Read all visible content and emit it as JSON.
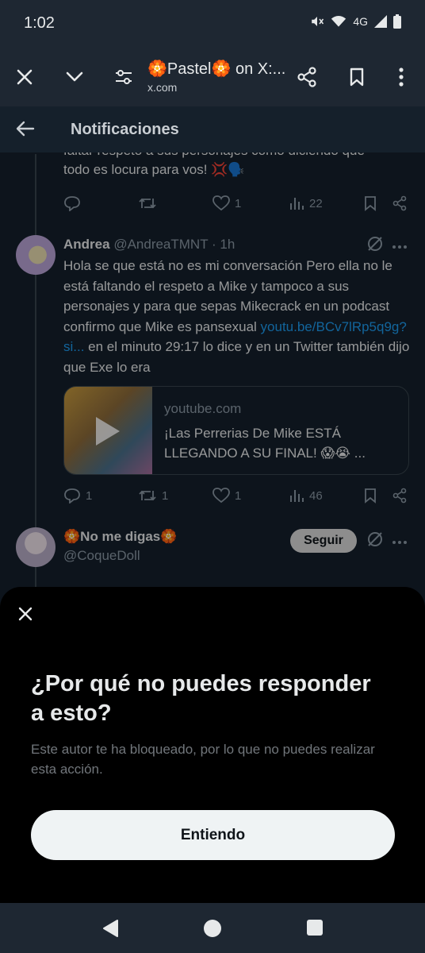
{
  "status_bar": {
    "time": "1:02",
    "network": "4G"
  },
  "browser": {
    "page_title": "🏵️Pastel🏵️ on X:...",
    "url": "x.com",
    "icons": [
      "close-icon",
      "chevron-down-icon",
      "page-settings-icon",
      "share-icon",
      "bookmark-icon",
      "more-vert-icon"
    ]
  },
  "header": {
    "title": "Notificaciones"
  },
  "prev_tweet": {
    "text_cut": "faltar respeto a sus personajes como diciendo que",
    "text_last": "todo es locura para vos! 💢🗣️",
    "actions": {
      "replies": "",
      "retweets": "",
      "likes": "1",
      "views": "22"
    }
  },
  "tweet": {
    "name": "Andrea",
    "handle": "@AndreaTMNT",
    "time": "· 1h",
    "text_before_link": "Hola se que está no es mi conversación Pero ella no le está faltando el respeto a Mike y tampoco a sus personajes y para que sepas Mikecrack en un podcast confirmo que Mike es pansexual ",
    "link": "youtu.be/BCv7lRp5q9g?si...",
    "text_after_link": " en el minuto 29:17 lo dice y en un Twitter también dijo que Exe lo era",
    "card": {
      "domain": "youtube.com",
      "title": "¡Las Perrerias De Mike ESTÁ LLEGANDO A SU FINAL! 😱😭 ..."
    },
    "actions": {
      "replies": "1",
      "retweets": "1",
      "likes": "1",
      "views": "46"
    }
  },
  "next_tweet": {
    "name": "🏵️No me digas🏵️",
    "handle": "@CoqueDoll",
    "follow_label": "Seguir"
  },
  "sheet": {
    "title": "¿Por qué no puedes responder a esto?",
    "description": "Este autor te ha bloqueado, por lo que no puedes realizar esta acción.",
    "button": "Entiendo"
  }
}
